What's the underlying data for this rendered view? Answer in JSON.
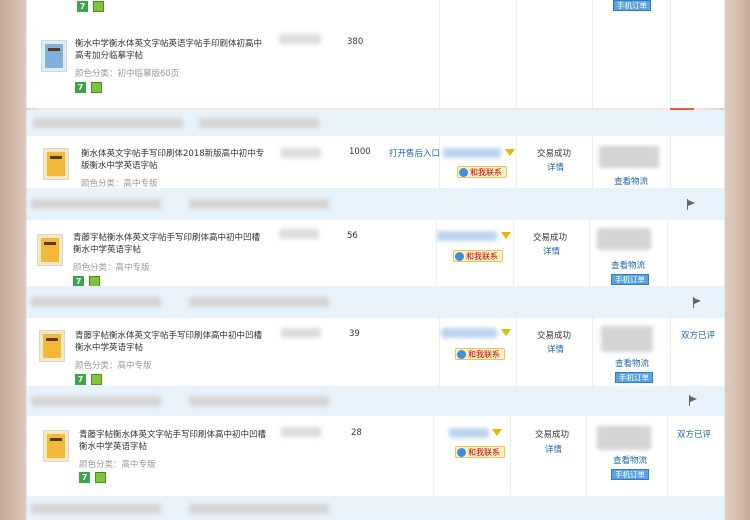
{
  "common": {
    "color_label": "颜色分类：",
    "contact_label": "和我联系",
    "trade_status": "交易成功",
    "detail_link": "详情",
    "logistics_link": "查看物流",
    "mobile_order_btn": "手机订单"
  },
  "orders": [
    {
      "title": "衡水中学衡水体英文字帖英语字帖手印刷体初高中高考加分临摹字帖",
      "color": "初中临摹版60页",
      "qty": "380"
    },
    {
      "title": "衡水体英文字帖手写印刷体2018新版高中初中专版衡水中学英语字帖",
      "color": "高中专版",
      "qty": "1000",
      "aftersale": "打开售后入口"
    },
    {
      "title": "青藤字帖衡水体英文字帖手写印刷体高中初中凹槽衡水中学英语字帖",
      "color": "高中专版",
      "qty": "56"
    },
    {
      "title": "青藤字帖衡水体英文字帖手写印刷体高中初中凹槽衡水中学英语字帖",
      "color": "高中专版",
      "qty": "39",
      "review": "双方已评"
    },
    {
      "title": "青藤字帖衡水体英文字帖手写印刷体高中初中凹槽衡水中学英语字帖",
      "color": "高中专版",
      "qty": "28",
      "review": "双方已评"
    }
  ],
  "icons": {
    "seven_day_badge": "7",
    "guarantee_badge": "shield-icon",
    "funnel": "funnel-icon",
    "flag": "flag-icon"
  },
  "colors": {
    "link_blue": "#1a66b3",
    "band_blue": "#e8f2fa",
    "contact_red": "#cc0000",
    "button_blue": "#5aa2e0"
  }
}
